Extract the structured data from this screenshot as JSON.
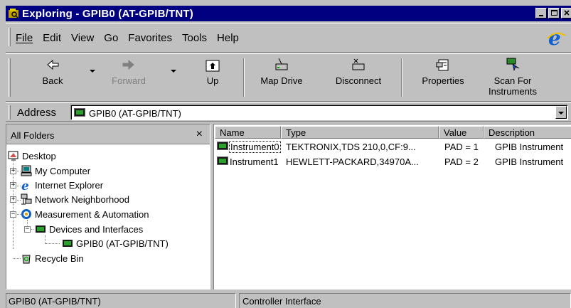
{
  "window": {
    "title": "Exploring - GPIB0 (AT-GPIB/TNT)"
  },
  "menu": [
    "File",
    "Edit",
    "View",
    "Go",
    "Favorites",
    "Tools",
    "Help"
  ],
  "toolbar": {
    "back": "Back",
    "forward": "Forward",
    "up": "Up",
    "map_drive": "Map Drive",
    "disconnect": "Disconnect",
    "properties": "Properties",
    "scan_line1": "Scan For",
    "scan_line2": "Instruments"
  },
  "address": {
    "label": "Address",
    "value": "GPIB0 (AT-GPIB/TNT)"
  },
  "folders": {
    "header": "All Folders",
    "close": "×",
    "items": [
      {
        "label": "Desktop",
        "icon": "desktop-icon"
      },
      {
        "label": "My Computer",
        "icon": "computer-icon"
      },
      {
        "label": "Internet Explorer",
        "icon": "ie-icon"
      },
      {
        "label": "Network Neighborhood",
        "icon": "network-icon"
      },
      {
        "label": "Measurement & Automation",
        "icon": "mx-icon"
      },
      {
        "label": "Devices and Interfaces",
        "icon": "devices-icon"
      },
      {
        "label": "GPIB0 (AT-GPIB/TNT)",
        "icon": "gpib-icon"
      },
      {
        "label": "Recycle Bin",
        "icon": "recycle-icon"
      }
    ]
  },
  "list": {
    "columns": [
      "Name",
      "Type",
      "Value",
      "Description"
    ],
    "rows": [
      {
        "name": "Instrument0",
        "type": "TEKTRONIX,TDS 210,0,CF:9...",
        "value": "PAD = 1",
        "description": "GPIB Instrument"
      },
      {
        "name": "Instrument1",
        "type": "HEWLETT-PACKARD,34970A...",
        "value": "PAD = 2",
        "description": "GPIB Instrument"
      }
    ]
  },
  "status": {
    "left": "GPIB0 (AT-GPIB/TNT)",
    "right": "Controller Interface"
  }
}
